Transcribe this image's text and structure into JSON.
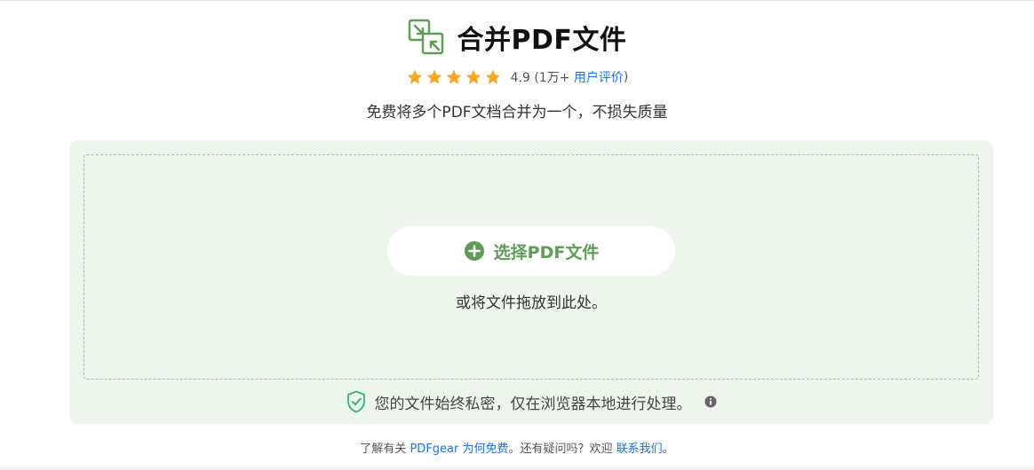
{
  "header": {
    "title": "合并PDF文件",
    "icon": "merge-pdf-icon"
  },
  "rating": {
    "stars": 5,
    "score_text": "4.9 (1万+ ",
    "reviews_link": "用户评价",
    "close_paren": ")"
  },
  "subtitle": "免费将多个PDF文档合并为一个，不损失质量",
  "upload": {
    "button_label": "选择PDF文件",
    "drop_hint": "或将文件拖放到此处。",
    "privacy_text": "您的文件始终私密，仅在浏览器本地进行处理。"
  },
  "footer": {
    "prefix": "了解有关 ",
    "link1": "PDFgear 为何免费",
    "middle": "。还有疑问吗？欢迎 ",
    "link2": "联系我们",
    "suffix": "。"
  },
  "colors": {
    "accent_green": "#5f9c58",
    "panel_bg": "#eef5ec",
    "star": "#f5a623",
    "link": "#1a73e8"
  }
}
